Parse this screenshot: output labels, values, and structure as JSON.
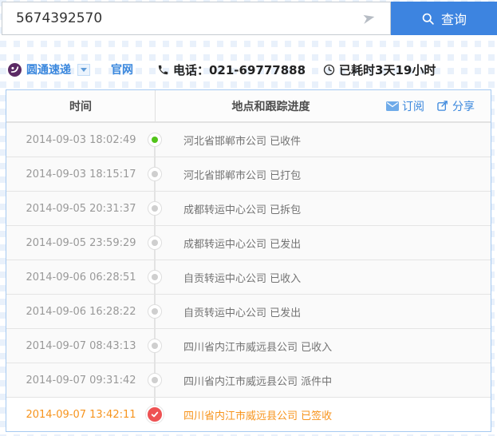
{
  "search": {
    "value": "5674392570",
    "button_label": "查询"
  },
  "courier": {
    "name": "圆通速递",
    "website_label": "官网",
    "phone_label": "电话：021-69777888",
    "elapsed_label": "已耗时3天19小时"
  },
  "table": {
    "time_header": "时间",
    "progress_header": "地点和跟踪进度",
    "subscribe_label": "订阅",
    "share_label": "分享",
    "rows": [
      {
        "time": "2014-09-03 18:02:49",
        "status": "河北省邯郸市公司 已收件",
        "marker": "received-start"
      },
      {
        "time": "2014-09-03 18:15:17",
        "status": "河北省邯郸市公司 已打包",
        "marker": "transit"
      },
      {
        "time": "2014-09-05 20:31:37",
        "status": "成都转运中心公司 已拆包",
        "marker": "transit"
      },
      {
        "time": "2014-09-05 23:59:29",
        "status": "成都转运中心公司 已发出",
        "marker": "transit"
      },
      {
        "time": "2014-09-06 06:28:51",
        "status": "自贡转运中心公司 已收入",
        "marker": "transit"
      },
      {
        "time": "2014-09-06 16:28:22",
        "status": "自贡转运中心公司 已发出",
        "marker": "transit"
      },
      {
        "time": "2014-09-07 08:43:13",
        "status": "四川省内江市威远县公司 已收入",
        "marker": "transit"
      },
      {
        "time": "2014-09-07 09:31:42",
        "status": "四川省内江市威远县公司 派件中",
        "marker": "transit"
      },
      {
        "time": "2014-09-07 13:42:11",
        "status": "四川省内江市威远县公司 已签收",
        "marker": "signed",
        "highlight": true
      }
    ]
  },
  "colors": {
    "accent_blue": "#3a87dd",
    "button_blue": "#3d84e0",
    "success_green": "#52c41a",
    "signed_red": "#ee5253",
    "highlight_orange": "#f7941d",
    "table_border": "#a5c9f1"
  }
}
